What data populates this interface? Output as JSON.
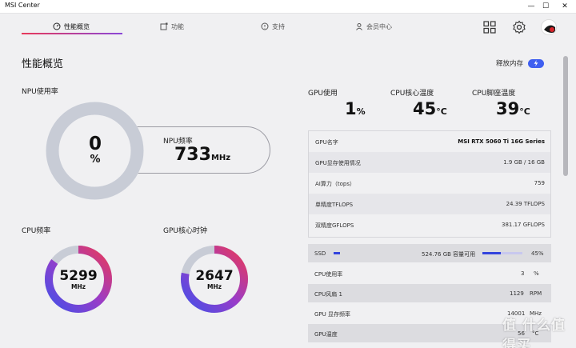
{
  "window": {
    "title": "MSI Center",
    "minimize": "—",
    "maximize": "☐",
    "close": "✕"
  },
  "nav": {
    "tabs": [
      {
        "label": "性能概览",
        "icon": "gauge-icon",
        "active": true
      },
      {
        "label": "功能",
        "icon": "feature-icon",
        "active": false
      },
      {
        "label": "支持",
        "icon": "support-icon",
        "active": false
      },
      {
        "label": "会员中心",
        "icon": "user-icon",
        "active": false
      }
    ],
    "accent_gradient": [
      "#e8395a",
      "#8a47d8"
    ]
  },
  "page": {
    "title": "性能概览",
    "release_memory": "释放内存"
  },
  "npu": {
    "usage_label": "NPU使用率",
    "usage_value": "0",
    "usage_unit": "%",
    "freq_label": "NPU频率",
    "freq_value": "733",
    "freq_unit": "MHz"
  },
  "cpu_freq": {
    "label": "CPU频率",
    "value": "5299",
    "unit": "MHz",
    "fill": 0.85
  },
  "gpu_clock": {
    "label": "GPU核心时钟",
    "value": "2647",
    "unit": "MHz",
    "fill": 0.78
  },
  "gpu_stats": [
    {
      "label": "GPU使用",
      "value": "1",
      "unit": "%"
    },
    {
      "label": "CPU核心温度",
      "value": "45",
      "unit": "°C"
    },
    {
      "label": "CPU脚座温度",
      "value": "39",
      "unit": "°C"
    }
  ],
  "gpu_info": [
    {
      "key": "GPU名字",
      "value": "MSI RTX 5060 Ti 16G Series"
    },
    {
      "key": "GPU显存使用情况",
      "value": "1.9 GB / 16 GB"
    },
    {
      "key": "AI算力（tops）",
      "value": "759"
    },
    {
      "key": "单精度TFLOPS",
      "value": "24.39 TFLOPS"
    },
    {
      "key": "双精度GFLOPS",
      "value": "381.17 GFLOPS"
    }
  ],
  "monitor": {
    "ssd": {
      "key": "SSD",
      "free": "524.76 GB 容量可用",
      "percent": "45%",
      "fill": 0.45
    },
    "rows": [
      {
        "key": "CPU使用率",
        "value": "3",
        "unit": "%"
      },
      {
        "key": "CPU风扇 1",
        "value": "1129",
        "unit": "RPM"
      },
      {
        "key": "GPU 显存频率",
        "value": "14001",
        "unit": "MHz"
      },
      {
        "key": "GPU温度",
        "value": "56",
        "unit": "°C"
      }
    ]
  },
  "watermark": "值 什么值得买"
}
